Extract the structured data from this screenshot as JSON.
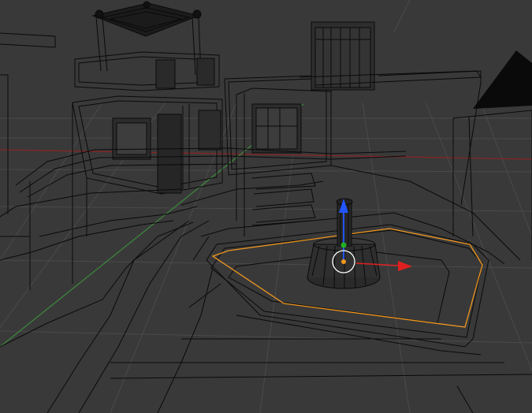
{
  "viewport": {
    "kind": "3d-viewport",
    "shading": "wireframe",
    "colors": {
      "background": "#393939",
      "grid": "#4a4a4a",
      "wire": "#0a0a0a",
      "x_axis": "#8b2424",
      "y_axis": "#3d8a3d",
      "selection": "#f0961e",
      "gizmo_x": "#e02020",
      "gizmo_y": "#22b022",
      "gizmo_z": "#2255ff",
      "cursor": "#ffffff"
    }
  },
  "scene": {
    "objects": [
      "pavilion-house",
      "tower-block",
      "pyramid",
      "terrace-steps",
      "fountain-basin",
      "fountain-column"
    ],
    "selected_object": "fountain-basin"
  },
  "gizmo": {
    "mode": "translate",
    "axes": [
      "x",
      "y",
      "z"
    ]
  }
}
